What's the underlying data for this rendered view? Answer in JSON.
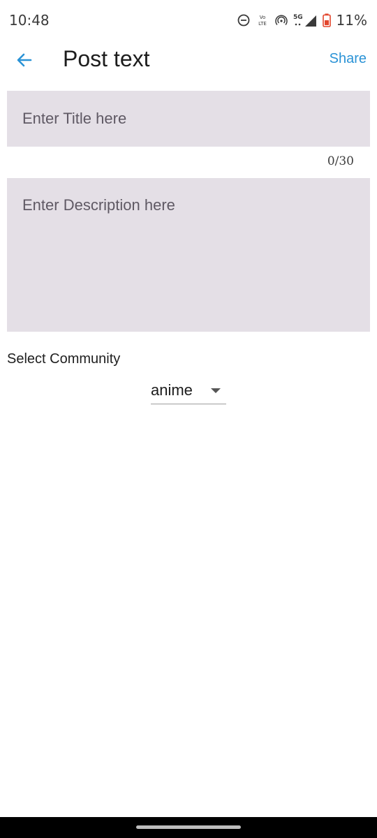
{
  "status_bar": {
    "time": "10:48",
    "network_label": "5G",
    "volte_label": "Vo LTE",
    "battery_percent": "11%",
    "icons": [
      "do-not-disturb-icon",
      "volte-icon",
      "hotspot-icon",
      "5g-signal-icon",
      "battery-low-icon"
    ],
    "battery_color": "#e2462d"
  },
  "app_bar": {
    "back_icon": "arrow-left-icon",
    "title": "Post text",
    "share_label": "Share",
    "accent_color": "#2b93d6"
  },
  "form": {
    "title_placeholder": "Enter Title here",
    "title_value": "",
    "title_counter": "0/30",
    "description_placeholder": "Enter Description here",
    "description_value": "",
    "field_background": "#e4dfe6"
  },
  "community": {
    "label": "Select Community",
    "selected": "anime",
    "dropdown_icon": "triangle-down-icon"
  },
  "nav_bar": {
    "home_handle": "home-gesture-handle"
  }
}
